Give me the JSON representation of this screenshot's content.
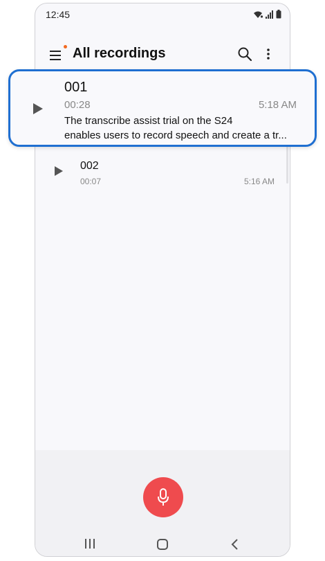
{
  "status_bar": {
    "time": "12:45",
    "icons": [
      "wifi-icon",
      "signal-icon",
      "battery-icon"
    ]
  },
  "app_bar": {
    "title": "All recordings",
    "menu_icon": "menu-icon",
    "notification_dot_color": "#f26a21",
    "search_icon": "search-icon",
    "more_icon": "more-vertical-icon"
  },
  "recordings": [
    {
      "title": "001",
      "duration": "00:28",
      "time": "5:18 AM",
      "transcript_line1": "The transcribe assist trial on the S24",
      "transcript_line2": "enables users to record speech and create a tr..."
    },
    {
      "title": "002",
      "duration": "00:07",
      "time": "5:16 AM"
    }
  ],
  "highlight_color": "#1f6fd1",
  "record_button": {
    "color": "#ef4b4e",
    "icon": "microphone-icon"
  },
  "nav_bar": {
    "icons": [
      "recents-icon",
      "home-icon",
      "back-icon"
    ]
  }
}
